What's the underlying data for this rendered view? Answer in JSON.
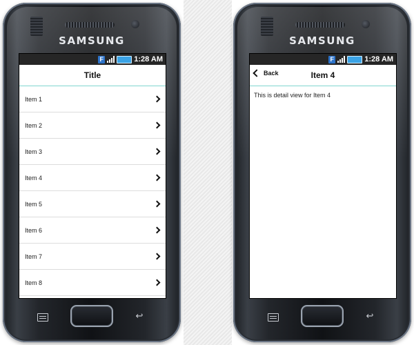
{
  "left_phone": {
    "brand": "SAMSUNG",
    "status": {
      "time": "1:28 AM",
      "app_icon_letter": "F"
    },
    "appbar": {
      "title": "Title"
    },
    "items": [
      {
        "label": "Item 1"
      },
      {
        "label": "Item 2"
      },
      {
        "label": "Item 3"
      },
      {
        "label": "Item 4"
      },
      {
        "label": "Item 5"
      },
      {
        "label": "Item 6"
      },
      {
        "label": "Item 7"
      },
      {
        "label": "Item 8"
      }
    ]
  },
  "right_phone": {
    "brand": "SAMSUNG",
    "status": {
      "time": "1:28 AM",
      "app_icon_letter": "F"
    },
    "appbar": {
      "title": "Item 4",
      "back_label": "Back"
    },
    "detail_text": "This is detail view for Item 4"
  },
  "colors": {
    "status_bar": "#262626",
    "appbar_divider": "#7fd6d0",
    "battery": "#3ba3e6",
    "app_icon": "#2d73c9"
  },
  "icons": [
    "chevron-right-icon",
    "chevron-left-icon",
    "menu-key-icon",
    "back-key-icon",
    "signal-icon",
    "battery-icon"
  ]
}
